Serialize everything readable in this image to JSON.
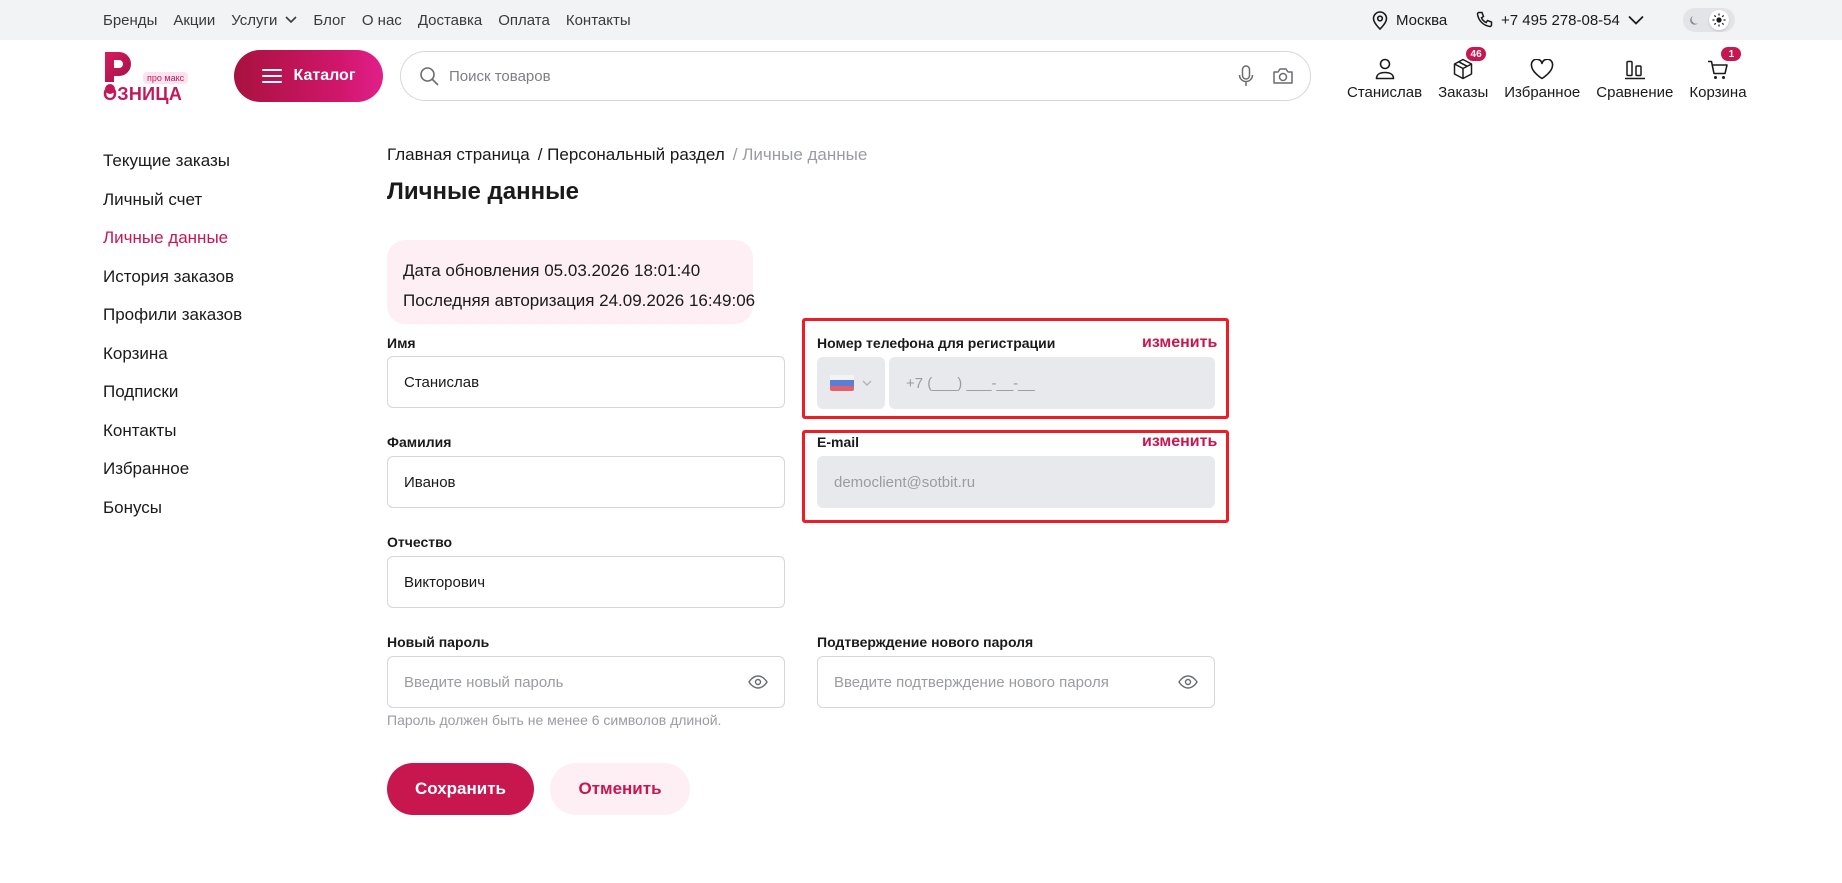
{
  "topnav": {
    "links": [
      "Бренды",
      "Акции",
      "Услуги",
      "Блог",
      "О нас",
      "Доставка",
      "Оплата",
      "Контакты"
    ],
    "city": "Москва",
    "phone": "+7 495 278-08-54"
  },
  "header": {
    "logo_text": "ОЗНИЦА",
    "logo_badge": "про макс",
    "catalog_label": "Каталог",
    "search_placeholder": "Поиск товаров",
    "items": [
      {
        "label": "Станислав",
        "icon": "user-icon"
      },
      {
        "label": "Заказы",
        "icon": "box-icon",
        "badge": "46"
      },
      {
        "label": "Избранное",
        "icon": "heart-icon"
      },
      {
        "label": "Сравнение",
        "icon": "compare-icon"
      },
      {
        "label": "Корзина",
        "icon": "cart-icon",
        "badge": "1"
      }
    ]
  },
  "sidebar": {
    "items": [
      "Текущие заказы",
      "Личный счет",
      "Личные данные",
      "История заказов",
      "Профили заказов",
      "Корзина",
      "Подписки",
      "Контакты",
      "Избранное",
      "Бонусы"
    ],
    "active": "Личные данные"
  },
  "breadcrumb": {
    "home": "Главная страница",
    "section": "/ Персональный раздел",
    "current": "/ Личные данные"
  },
  "page": {
    "title": "Личные данные",
    "updated": "Дата обновления 05.03.2026 18:01:40",
    "last_login": "Последняя авторизация 24.09.2026 16:49:06"
  },
  "form": {
    "first_name": {
      "label": "Имя",
      "value": "Станислав"
    },
    "last_name": {
      "label": "Фамилия",
      "value": "Иванов"
    },
    "middle_name": {
      "label": "Отчество",
      "value": "Викторович"
    },
    "phone": {
      "label": "Номер телефона для регистрации",
      "placeholder": "+7 (___) ___-__-__",
      "change": "изменить"
    },
    "email": {
      "label": "E-mail",
      "value": "democlient@sotbit.ru",
      "change": "изменить"
    },
    "new_password": {
      "label": "Новый пароль",
      "placeholder": "Введите новый пароль"
    },
    "confirm_password": {
      "label": "Подтверждение нового пароля",
      "placeholder": "Введите подтверждение нового пароля"
    },
    "password_hint": "Пароль должен быть не менее 6 символов длиной.",
    "save": "Сохранить",
    "cancel": "Отменить"
  },
  "colors": {
    "accent": "#c8174f",
    "highlight": "#ee1c25"
  }
}
